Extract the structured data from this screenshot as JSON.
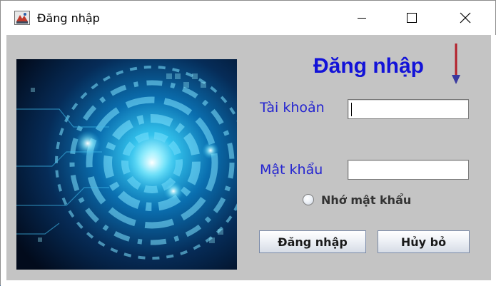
{
  "window": {
    "title": "Đăng nhập",
    "icons": {
      "app": "java-app-icon",
      "minimize": "minimize-icon",
      "maximize": "maximize-icon",
      "close": "close-icon"
    }
  },
  "form": {
    "heading": "Đăng nhập",
    "heading_color": "#1313d8",
    "label_color": "#2424d0",
    "decorative_image": "abstract-tech-circle-image",
    "arrow_icon": "down-arrow-icon",
    "username": {
      "label": "Tài khoản",
      "value": "",
      "placeholder": ""
    },
    "password": {
      "label": "Mật khẩu",
      "value": "",
      "placeholder": ""
    },
    "remember": {
      "label": "Nhớ mật khẩu",
      "checked": false
    },
    "buttons": {
      "login": "Đăng nhập",
      "cancel": "Hủy bỏ"
    }
  }
}
